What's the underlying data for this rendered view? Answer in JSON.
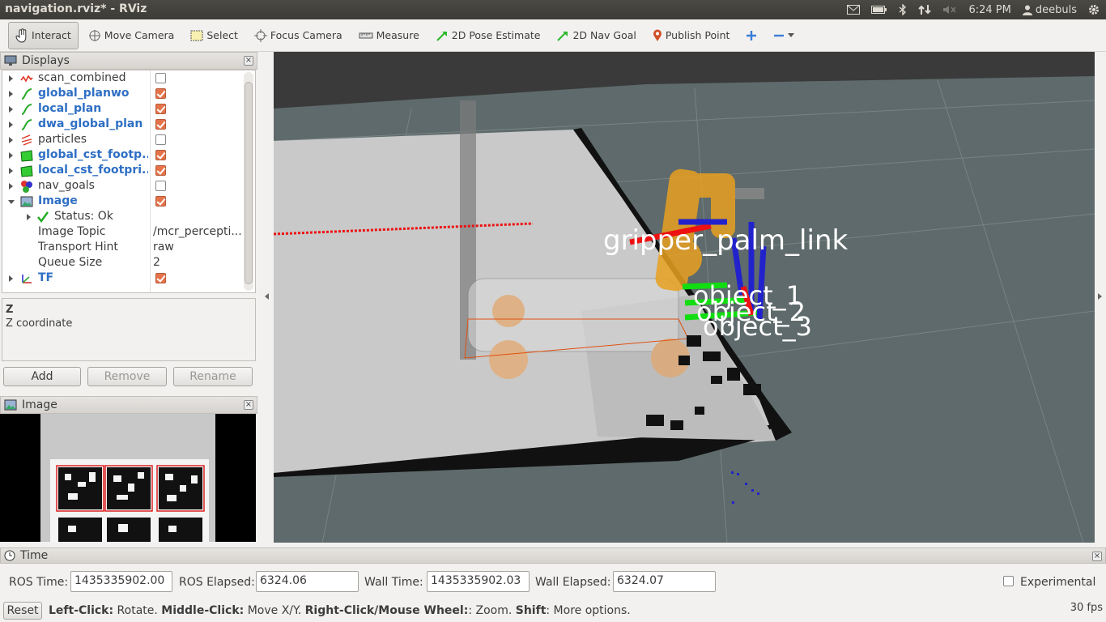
{
  "window": {
    "title": "navigation.rviz* - RViz",
    "clock": "6:24 PM",
    "user": "deebuls"
  },
  "toolbar": {
    "tools": [
      {
        "label": "Interact",
        "icon": "hand-icon",
        "active": true
      },
      {
        "label": "Move Camera",
        "icon": "move-camera-icon"
      },
      {
        "label": "Select",
        "icon": "select-icon"
      },
      {
        "label": "Focus Camera",
        "icon": "focus-camera-icon"
      },
      {
        "label": "Measure",
        "icon": "ruler-icon"
      },
      {
        "label": "2D Pose Estimate",
        "icon": "pose-arrow-icon"
      },
      {
        "label": "2D Nav Goal",
        "icon": "nav-arrow-icon"
      },
      {
        "label": "Publish Point",
        "icon": "pin-icon"
      }
    ]
  },
  "displays": {
    "title": "Displays",
    "items": [
      {
        "name": "scan_combined",
        "checked": false,
        "highlight": false,
        "icon": "laser-scan-icon"
      },
      {
        "name": "global_planwo",
        "checked": true,
        "highlight": true,
        "icon": "path-icon"
      },
      {
        "name": "local_plan",
        "checked": true,
        "highlight": true,
        "icon": "path-icon"
      },
      {
        "name": "dwa_global_plan",
        "checked": true,
        "highlight": true,
        "icon": "path-icon"
      },
      {
        "name": "particles",
        "checked": false,
        "highlight": false,
        "icon": "pose-array-icon"
      },
      {
        "name": "global_cst_footp...",
        "checked": true,
        "highlight": true,
        "icon": "polygon-icon"
      },
      {
        "name": "local_cst_footpri...",
        "checked": true,
        "highlight": true,
        "icon": "polygon-icon"
      },
      {
        "name": "nav_goals",
        "checked": false,
        "highlight": false,
        "icon": "marker-icon"
      },
      {
        "name": "Image",
        "checked": true,
        "highlight": true,
        "icon": "image-icon"
      }
    ],
    "image_props": {
      "status_label": "Status: Ok",
      "topic_label": "Image Topic",
      "topic_value": "/mcr_percepti...",
      "hint_label": "Transport Hint",
      "hint_value": "raw",
      "queue_label": "Queue Size",
      "queue_value": "2"
    },
    "tf_item": {
      "name": "TF",
      "checked": true
    }
  },
  "description": {
    "title": "Z",
    "text": "Z coordinate"
  },
  "buttons": {
    "add": "Add",
    "remove": "Remove",
    "rename": "Rename"
  },
  "image_panel": {
    "title": "Image"
  },
  "viewport": {
    "labels": [
      "gripper_palm_link",
      "object_1",
      "object_2",
      "object_3"
    ]
  },
  "time": {
    "title": "Time",
    "ros_time_label": "ROS Time:",
    "ros_time": "1435335902.00",
    "ros_elapsed_label": "ROS Elapsed:",
    "ros_elapsed": "6324.06",
    "wall_time_label": "Wall Time:",
    "wall_time": "1435335902.03",
    "wall_elapsed_label": "Wall Elapsed:",
    "wall_elapsed": "6324.07",
    "experimental_label": "Experimental",
    "experimental": false
  },
  "status": {
    "reset": "Reset",
    "hint_parts": [
      {
        "bold": "Left-Click:",
        "text": " Rotate. "
      },
      {
        "bold": "Middle-Click:",
        "text": " Move X/Y. "
      },
      {
        "bold": "Right-Click/Mouse Wheel:",
        "text": ": Zoom. "
      },
      {
        "bold": "Shift",
        "text": ": More options."
      }
    ],
    "fps": "30 fps"
  }
}
